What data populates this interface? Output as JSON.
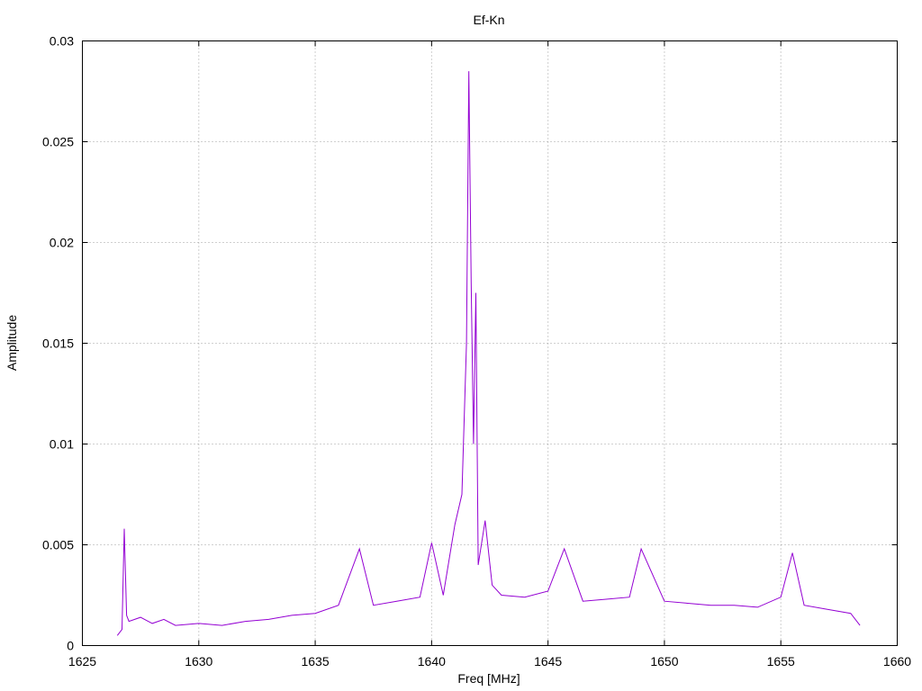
{
  "chart_data": {
    "type": "line",
    "title": "Ef-Kn",
    "xlabel": "Freq [MHz]",
    "ylabel": "Amplitude",
    "xlim": [
      1625,
      1660
    ],
    "ylim": [
      0,
      0.03
    ],
    "xticks": [
      1625,
      1630,
      1635,
      1640,
      1645,
      1650,
      1655,
      1660
    ],
    "xtick_labels": [
      "1625",
      "1630",
      "1635",
      "1640",
      "1645",
      "1650",
      "1655",
      "1660"
    ],
    "yticks": [
      0,
      0.005,
      0.01,
      0.015,
      0.02,
      0.025,
      0.03
    ],
    "ytick_labels": [
      "0",
      "0.005",
      "0.01",
      "0.015",
      "0.02",
      "0.025",
      "0.03"
    ],
    "grid": true,
    "series": [
      {
        "color": "#9400d3",
        "x": [
          1626.5,
          1626.7,
          1626.8,
          1626.9,
          1627.0,
          1627.5,
          1628.0,
          1628.5,
          1629.0,
          1630.0,
          1631.0,
          1632.0,
          1633.0,
          1634.0,
          1635.0,
          1636.0,
          1636.9,
          1637.5,
          1638.5,
          1639.5,
          1640.0,
          1640.5,
          1641.0,
          1641.3,
          1641.5,
          1641.6,
          1641.7,
          1641.8,
          1641.9,
          1642.0,
          1642.3,
          1642.6,
          1643.0,
          1644.0,
          1645.0,
          1645.7,
          1646.5,
          1647.5,
          1648.5,
          1649.0,
          1650.0,
          1651.0,
          1652.0,
          1653.0,
          1654.0,
          1655.0,
          1655.5,
          1656.0,
          1657.0,
          1658.0,
          1658.4
        ],
        "y": [
          0.0005,
          0.0008,
          0.0058,
          0.0015,
          0.0012,
          0.0014,
          0.0011,
          0.0013,
          0.001,
          0.0011,
          0.001,
          0.0012,
          0.0013,
          0.0015,
          0.0016,
          0.002,
          0.0048,
          0.002,
          0.0022,
          0.0024,
          0.0051,
          0.0025,
          0.006,
          0.0075,
          0.015,
          0.0285,
          0.018,
          0.01,
          0.0175,
          0.004,
          0.0062,
          0.003,
          0.0025,
          0.0024,
          0.0027,
          0.0048,
          0.0022,
          0.0023,
          0.0024,
          0.0048,
          0.0022,
          0.0021,
          0.002,
          0.002,
          0.0019,
          0.0024,
          0.0046,
          0.002,
          0.0018,
          0.0016,
          0.001
        ]
      }
    ]
  }
}
